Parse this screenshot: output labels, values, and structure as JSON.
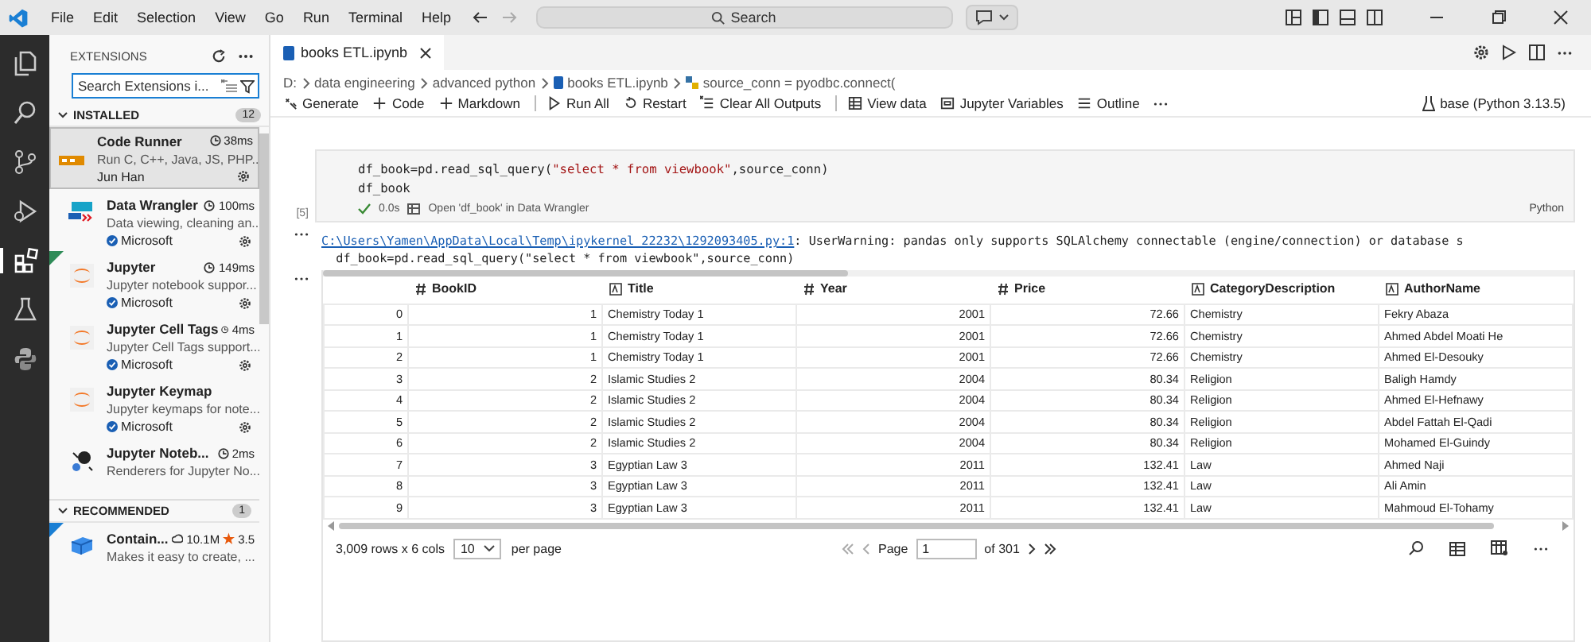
{
  "menu": [
    "File",
    "Edit",
    "Selection",
    "View",
    "Go",
    "Run",
    "Terminal",
    "Help"
  ],
  "search": {
    "placeholder": "Search"
  },
  "sidebar": {
    "title": "EXTENSIONS",
    "search": {
      "placeholder": "Search Extensions i..."
    },
    "installed": {
      "label": "INSTALLED",
      "count": "12",
      "expanded": true
    },
    "items": [
      {
        "name": "Code Runner",
        "time": "38ms",
        "description": "Run C, C++, Java, JS, PHP...",
        "publisher": "Jun Han",
        "verified": false,
        "selected": true,
        "badge": false
      },
      {
        "name": "Data Wrangler",
        "time": "100ms",
        "description": "Data viewing, cleaning an...",
        "publisher": "Microsoft",
        "verified": true,
        "selected": false,
        "badge": false
      },
      {
        "name": "Jupyter",
        "time": "149ms",
        "description": "Jupyter notebook suppor...",
        "publisher": "Microsoft",
        "verified": true,
        "selected": false,
        "badge": true
      },
      {
        "name": "Jupyter Cell Tags",
        "time": "4ms",
        "description": "Jupyter Cell Tags support...",
        "publisher": "Microsoft",
        "verified": true,
        "selected": false,
        "badge": false
      },
      {
        "name": "Jupyter Keymap",
        "description": "Jupyter keymaps for note...",
        "publisher": "Microsoft",
        "verified": true,
        "selected": false,
        "badge": false
      },
      {
        "name": "Jupyter Noteb...",
        "time": "2ms",
        "description": "Renderers for Jupyter No...",
        "selected": false,
        "badge": false
      }
    ],
    "recommended": {
      "label": "RECOMMENDED",
      "count": "1",
      "expanded": true,
      "items": [
        {
          "name": "Contain...",
          "downloads": "10.1M",
          "rating": "3.5",
          "description": "Makes it easy to create, ..."
        }
      ]
    }
  },
  "editor": {
    "tab": {
      "label": "books ETL.ipynb",
      "selected": true
    },
    "breadcrumbs": [
      "D:",
      "data engineering",
      "advanced python",
      "books ETL.ipynb",
      "source_conn = pyodbc.connect("
    ],
    "toolbar": [
      "Generate",
      "Code",
      "Markdown",
      "Run All",
      "Restart",
      "Clear All Outputs",
      "View data",
      "Jupyter Variables",
      "Outline"
    ],
    "kernel": "base (Python 3.13.5)",
    "cell": {
      "exec_count": "[5]",
      "code": [
        [
          {
            "kind": "plain",
            "text": "df_book=pd.read_sql_query("
          },
          {
            "kind": "string",
            "text": "\"select * from viewbook\""
          },
          {
            "kind": "plain",
            "text": ",source_conn)"
          }
        ],
        [
          {
            "kind": "plain",
            "text": "df_book"
          }
        ]
      ],
      "status": "0.0s",
      "wrangler": "Open 'df_book' in Data Wrangler",
      "language": "Python"
    },
    "output": {
      "warning_link": "C:\\Users\\Yamen\\AppData\\Local\\Temp\\ipykernel_22232\\1292093405.py:1",
      "warning_text": ": UserWarning: pandas only supports SQLAlchemy connectable (engine/connection) or database s",
      "code_line": "  df_book=pd.read_sql_query(\"select * from viewbook\",source_conn)"
    },
    "table": {
      "columns": [
        {
          "name": "BookID",
          "kind": "number"
        },
        {
          "name": "Title",
          "kind": "text"
        },
        {
          "name": "Year",
          "kind": "number"
        },
        {
          "name": "Price",
          "kind": "number"
        },
        {
          "name": "CategoryDescription",
          "kind": "text"
        },
        {
          "name": "AuthorName",
          "kind": "text"
        }
      ],
      "rows": [
        {
          "index": "0",
          "cells": [
            "1",
            "Chemistry Today 1",
            "2001",
            "72.66",
            "Chemistry",
            "Fekry Abaza"
          ]
        },
        {
          "index": "1",
          "cells": [
            "1",
            "Chemistry Today 1",
            "2001",
            "72.66",
            "Chemistry",
            "Ahmed Abdel Moati He"
          ]
        },
        {
          "index": "2",
          "cells": [
            "1",
            "Chemistry Today 1",
            "2001",
            "72.66",
            "Chemistry",
            "Ahmed El-Desouky"
          ]
        },
        {
          "index": "3",
          "cells": [
            "2",
            "Islamic Studies 2",
            "2004",
            "80.34",
            "Religion",
            "Baligh Hamdy"
          ]
        },
        {
          "index": "4",
          "cells": [
            "2",
            "Islamic Studies 2",
            "2004",
            "80.34",
            "Religion",
            "Ahmed El-Hefnawy"
          ]
        },
        {
          "index": "5",
          "cells": [
            "2",
            "Islamic Studies 2",
            "2004",
            "80.34",
            "Religion",
            "Abdel Fattah El-Qadi"
          ]
        },
        {
          "index": "6",
          "cells": [
            "2",
            "Islamic Studies 2",
            "2004",
            "80.34",
            "Religion",
            "Mohamed El-Guindy"
          ]
        },
        {
          "index": "7",
          "cells": [
            "3",
            "Egyptian Law 3",
            "2011",
            "132.41",
            "Law",
            "Ahmed Naji"
          ]
        },
        {
          "index": "8",
          "cells": [
            "3",
            "Egyptian Law 3",
            "2011",
            "132.41",
            "Law",
            "Ali Amin"
          ]
        },
        {
          "index": "9",
          "cells": [
            "3",
            "Egyptian Law 3",
            "2011",
            "132.41",
            "Law",
            "Mahmoud El-Tohamy"
          ]
        }
      ],
      "summary": "3,009 rows x 6 cols",
      "page_size": "10",
      "per_page": "per page",
      "page_label": "Page",
      "page": "1",
      "page_total": "of 301"
    }
  }
}
